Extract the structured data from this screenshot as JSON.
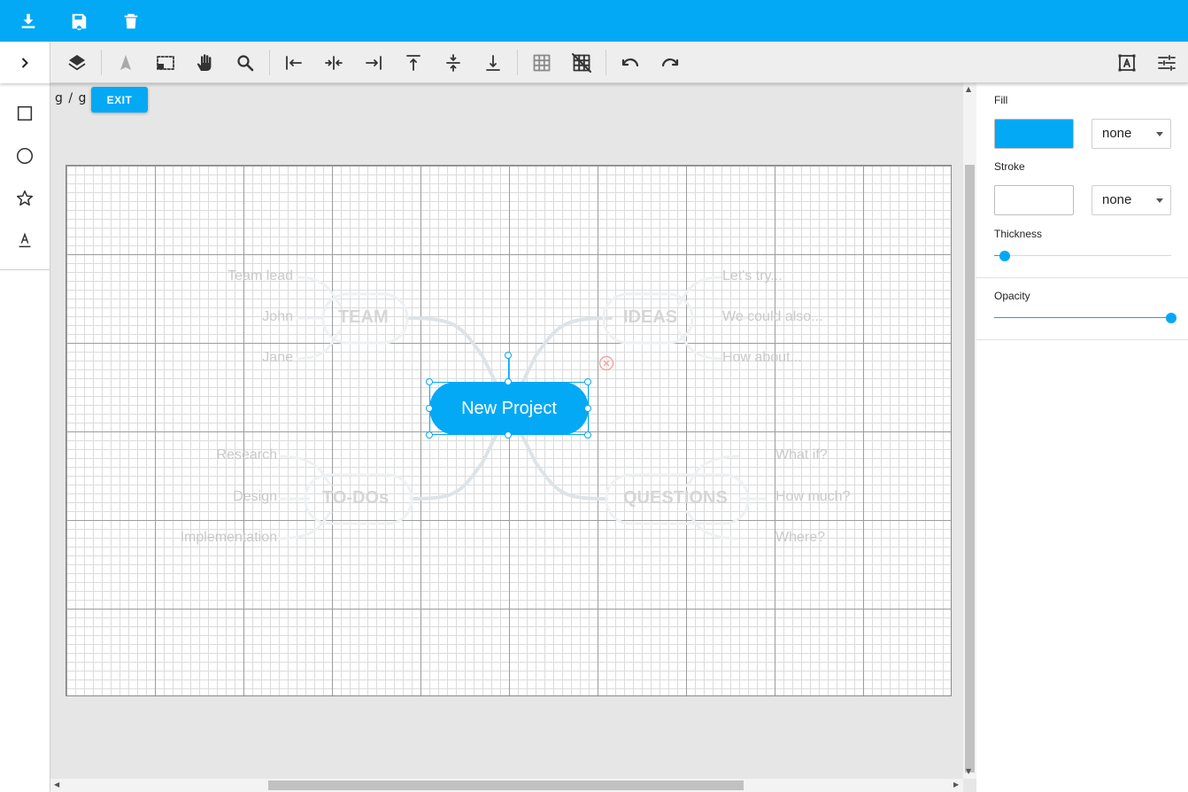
{
  "topbar": {
    "buttons": [
      {
        "name": "download",
        "icon": "download-icon"
      },
      {
        "name": "save",
        "icon": "save-icon"
      },
      {
        "name": "delete",
        "icon": "trash-icon"
      }
    ]
  },
  "toolbar": {
    "tools": [
      "layers-icon",
      "select-arrow-icon",
      "marquee-select-icon",
      "pan-hand-icon",
      "zoom-icon",
      "align-left-icon",
      "align-center-icon",
      "align-right-icon",
      "align-top-icon",
      "align-middle-icon",
      "align-bottom-icon",
      "grid-icon",
      "grid-snap-icon",
      "undo-icon",
      "redo-icon",
      "text-frame-icon",
      "settings-sliders-icon"
    ]
  },
  "leftbar": {
    "tools": [
      "rectangle-icon",
      "circle-icon",
      "star-icon",
      "text-icon"
    ]
  },
  "breadcrumb": "g / g /",
  "exit_label": "EXIT",
  "mindmap": {
    "center": "New Project",
    "categories": {
      "team": "TEAM",
      "ideas": "IDEAS",
      "todos": "TO-DOs",
      "questions": "QUESTIONS"
    },
    "team_items": [
      "Team lead",
      "John",
      "Jane"
    ],
    "ideas_items": [
      "Let's try...",
      "We could also...",
      "How about..."
    ],
    "todo_items": [
      "Research",
      "Design",
      "Implementation"
    ],
    "question_items": [
      "What if?",
      "How much?",
      "Where?"
    ]
  },
  "panel": {
    "fill_label": "Fill",
    "fill_color": "#03a9f4",
    "fill_value": "none",
    "stroke_label": "Stroke",
    "stroke_color": "#ffffff",
    "stroke_value": "none",
    "thickness_label": "Thickness",
    "thickness": 0.06,
    "opacity_label": "Opacity",
    "opacity": 1.0
  },
  "colors": {
    "accent": "#03a9f4",
    "toolbar_bg": "#eeeeee",
    "workspace_bg": "#e6e6e6"
  }
}
